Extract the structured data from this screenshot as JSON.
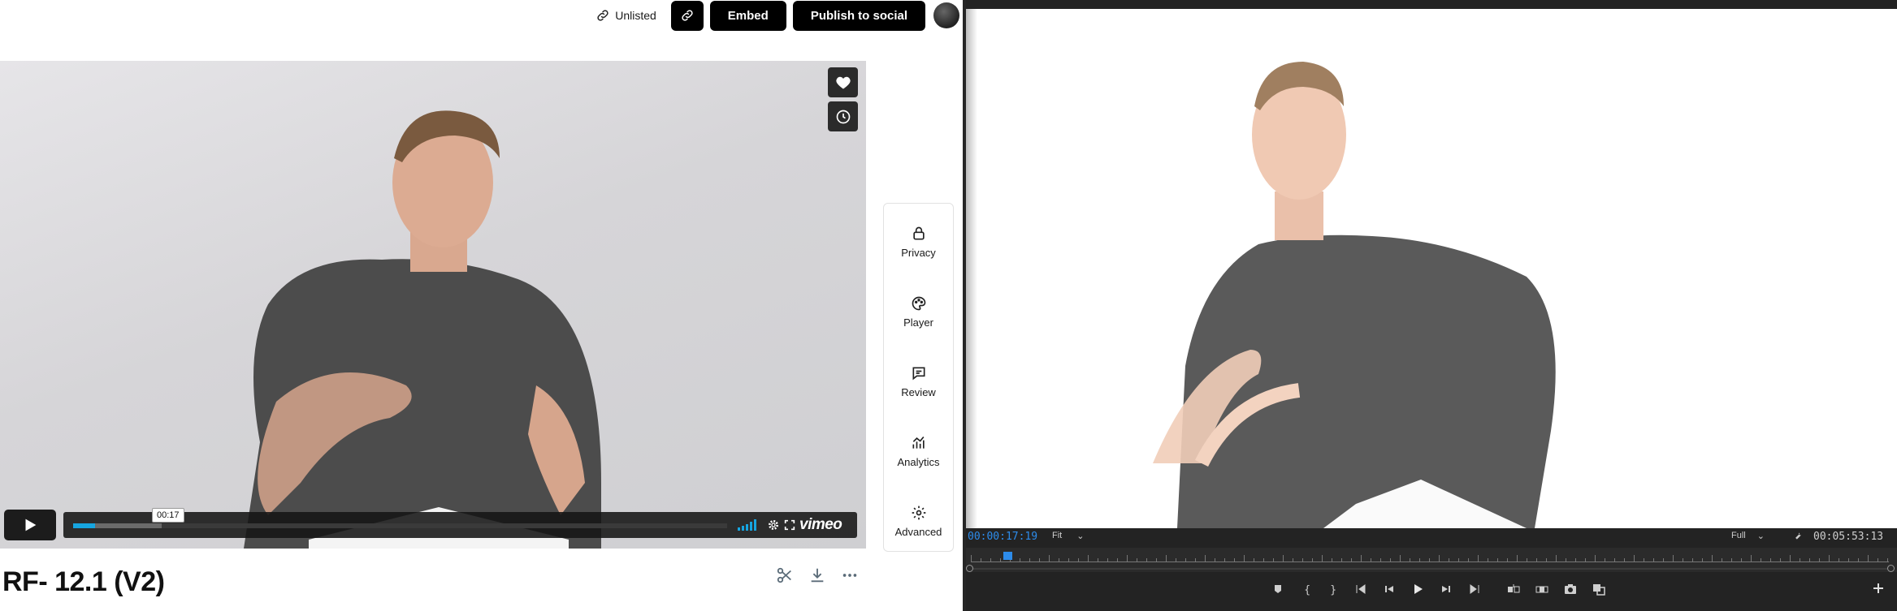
{
  "vimeo": {
    "topbar": {
      "privacy_status": "Unlisted",
      "copy_link_icon": "link-icon",
      "embed_label": "Embed",
      "publish_label": "Publish to social"
    },
    "player": {
      "like_icon": "heart-icon",
      "watch_later_icon": "clock-icon",
      "play_icon": "play-icon",
      "hover_time": "00:17",
      "progress": 0.034,
      "buffered": 0.136,
      "logo": "vimeo",
      "accent": "#16a5e0"
    },
    "panel": {
      "items": [
        {
          "label": "Privacy",
          "icon": "lock-icon"
        },
        {
          "label": "Player",
          "icon": "palette-icon"
        },
        {
          "label": "Review",
          "icon": "comment-icon"
        },
        {
          "label": "Analytics",
          "icon": "analytics-icon"
        },
        {
          "label": "Advanced",
          "icon": "gear-icon"
        }
      ]
    },
    "video_title": "RF- 12.1 (V2)",
    "title_actions": [
      "scissors-icon",
      "download-icon",
      "more-icon"
    ]
  },
  "premiere": {
    "current_time": "00:00:17:19",
    "fit": "Fit",
    "resolution": "Full",
    "duration": "00:05:53:13",
    "timecode_color": "#2d8ceb"
  }
}
